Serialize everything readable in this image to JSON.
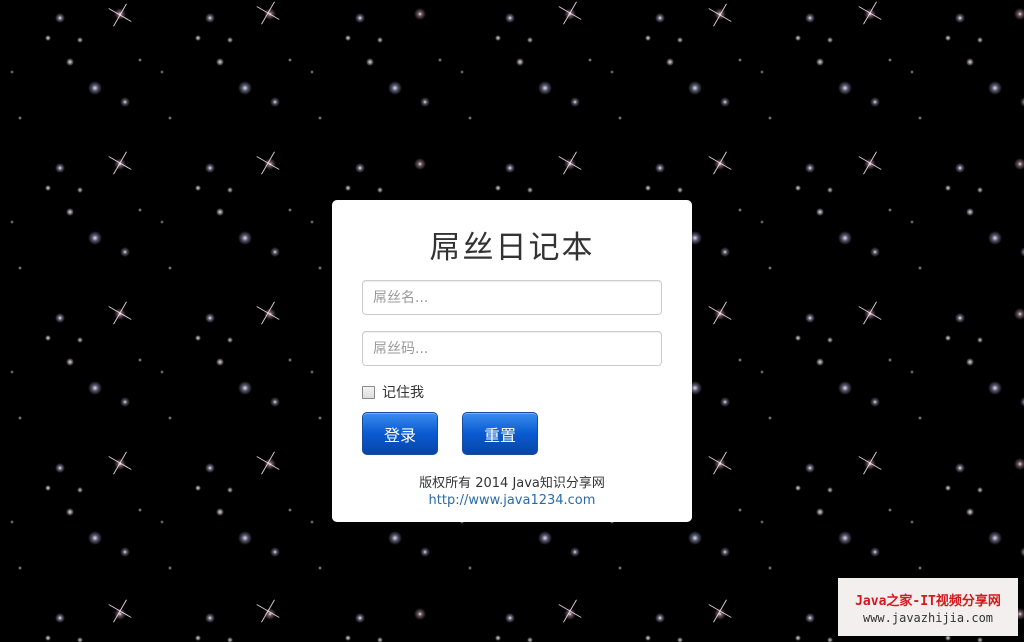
{
  "login": {
    "title": "屌丝日记本",
    "username_placeholder": "屌丝名...",
    "password_placeholder": "屌丝码...",
    "username_value": "",
    "password_value": "",
    "remember_label": "记住我",
    "remember_checked": false,
    "login_label": "登录",
    "reset_label": "重置"
  },
  "footer": {
    "copyright": "版权所有 2014 Java知识分享网",
    "link": "http://www.java1234.com"
  },
  "watermark": {
    "title": "Java之家-IT视频分享网",
    "url": "www.javazhijia.com"
  },
  "colors": {
    "background": "#000000",
    "panel": "#ffffff",
    "button_primary": "#0a5ad1",
    "link": "#2a6aa8",
    "watermark_title": "#d4181b"
  }
}
